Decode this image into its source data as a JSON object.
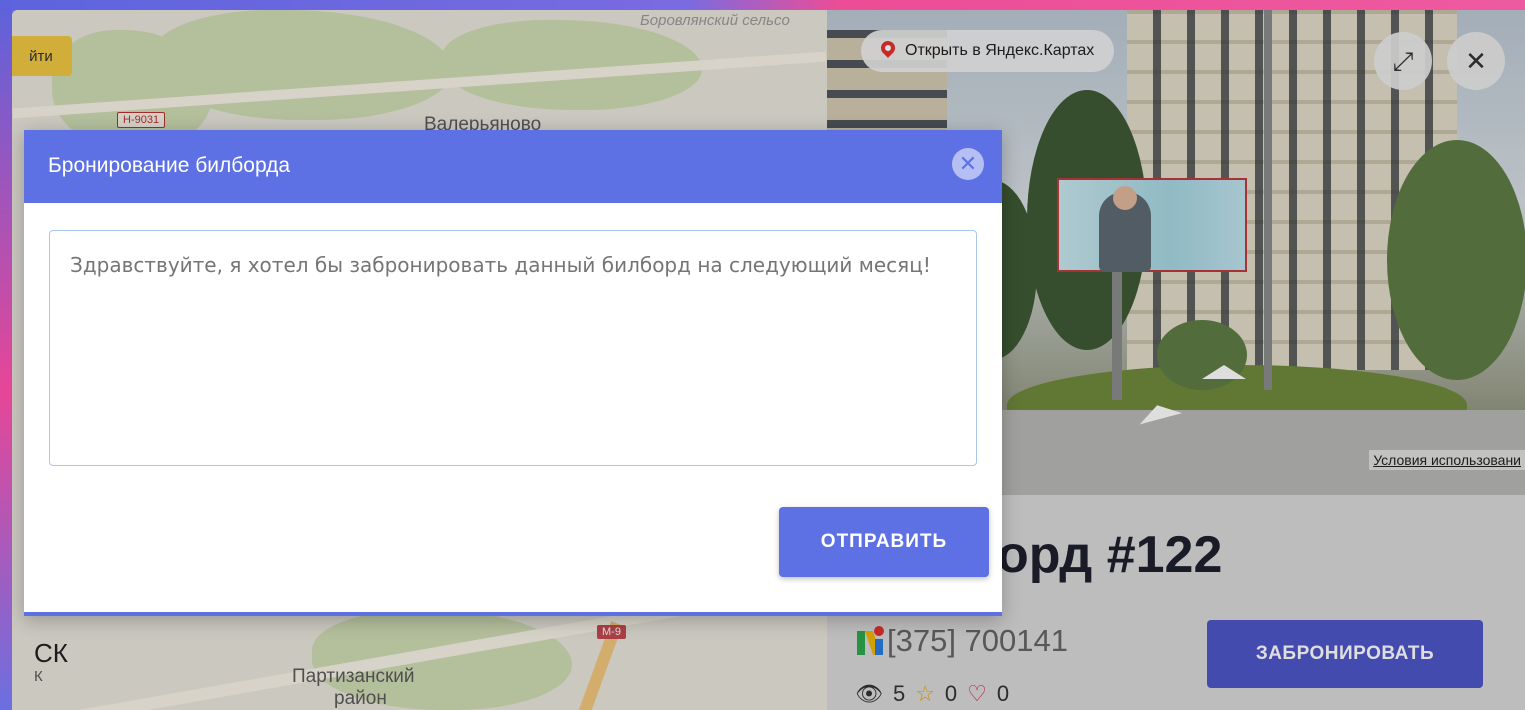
{
  "map": {
    "find_button": "йти",
    "labels": {
      "valeryanovo": "Валерьяново",
      "borovlyany": "Боровлянский сельсо",
      "city": "СК",
      "city_small": "К",
      "partizansky_1": "Партизанский",
      "partizansky_2": "район"
    },
    "road_signs": {
      "h9031": "Н-9031",
      "m9": "М-9"
    }
  },
  "panorama": {
    "open_yandex": "Открыть в Яндекс.Картах",
    "terms": "Условия использовани"
  },
  "billboard": {
    "title": "орд #122",
    "code": "[375] 700141",
    "views": "5",
    "stars": "0",
    "likes": "0",
    "book_button": "ЗАБРОНИРОВАТЬ"
  },
  "modal": {
    "title": "Бронирование билборда",
    "message_placeholder": "Здравствуйте, я хотел бы забронировать данный билборд на следующий месяц!",
    "send_button": "ОТПРАВИТЬ"
  },
  "colors": {
    "accent": "#5e71e4",
    "book_button": "#4e57c8"
  }
}
